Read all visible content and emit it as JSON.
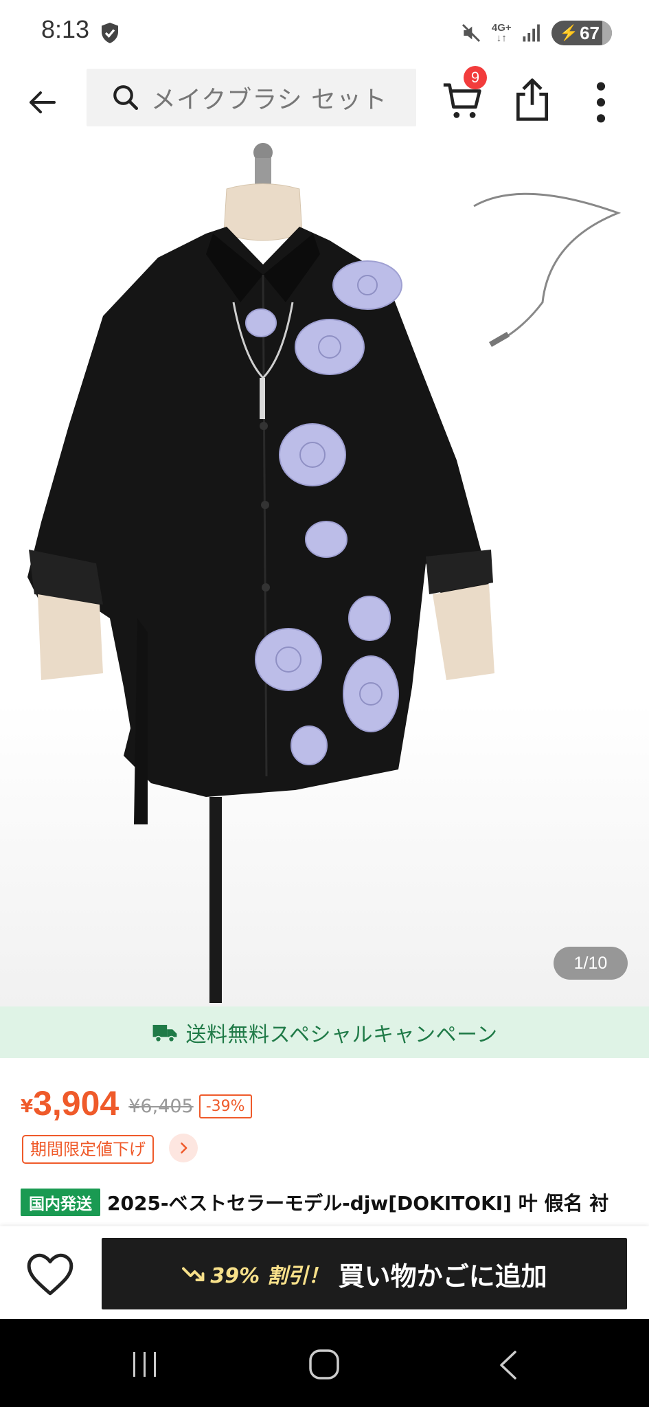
{
  "status_bar": {
    "time": "8:13",
    "network_top": "4G+",
    "network_bottom": "↓↑",
    "battery": "67",
    "icons": [
      "shield-check-icon",
      "mute-icon",
      "signal-icon",
      "battery-charging-icon"
    ]
  },
  "header": {
    "search_placeholder": "メイクブラシ セット",
    "cart_count": "9",
    "icons": [
      "back-arrow-icon",
      "search-icon",
      "cart-icon",
      "share-icon",
      "more-vertical-icon"
    ]
  },
  "gallery": {
    "counter": "1/10"
  },
  "campaign": {
    "text": "送料無料スペシャルキャンペーン",
    "color": "#1f7a47",
    "background": "#dff3e6"
  },
  "price": {
    "currency": "¥",
    "current": "3,904",
    "original": "¥6,405",
    "discount": "-39%",
    "accent_color": "#ef5a2a"
  },
  "promo_badge": {
    "label": "期間限定値下げ"
  },
  "product": {
    "shipping_tag": "国内発送",
    "title": "2025-ベストセラーモデル-djw[DOKITOKI] 叶 假名 衬"
  },
  "bottom_bar": {
    "promo_text": "39% 割引！",
    "add_to_cart": "買い物かごに追加"
  }
}
